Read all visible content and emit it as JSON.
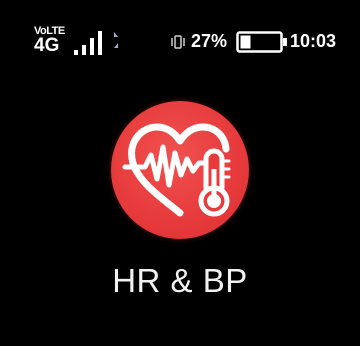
{
  "status_bar": {
    "volte_label": "VoLTE",
    "network_type": "4G",
    "signal_icon": "signal-bars-icon",
    "sound_icon": "vibrate-mode-icon",
    "battery_percent": "27%",
    "battery_level": 0.27,
    "battery_icon": "battery-icon",
    "time": "10:03"
  },
  "app": {
    "icon": "heart-rate-thermometer-icon",
    "label": "HR & BP",
    "icon_color": "#e63a3b"
  }
}
